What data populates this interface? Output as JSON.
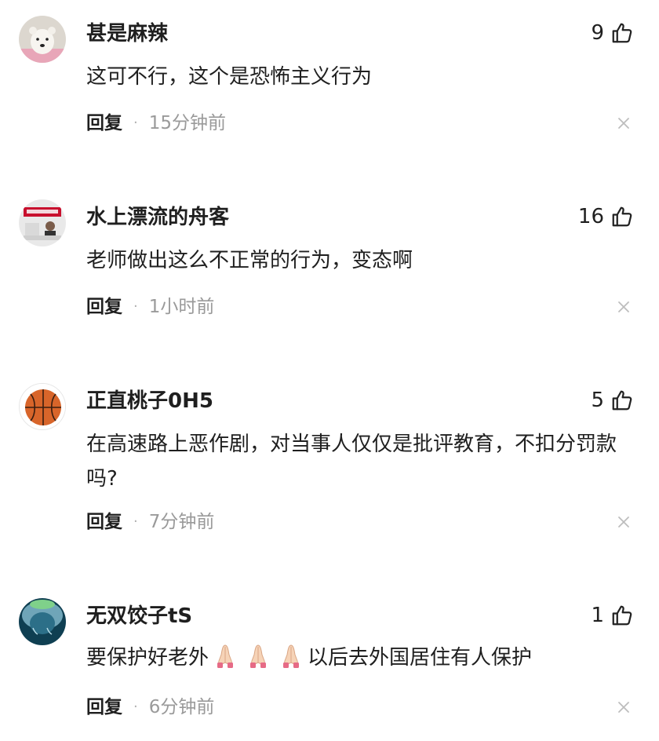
{
  "comments": [
    {
      "avatar_icon": "polar-bear-avatar",
      "name": "甚是麻辣",
      "likes": "9",
      "text": "这可不行，这个是恐怖主义行为",
      "reply_label": "回复",
      "time": "15分钟前"
    },
    {
      "avatar_icon": "office-photo-avatar",
      "name": "水上漂流的舟客",
      "likes": "16",
      "text": "老师做出这么不正常的行为，变态啊",
      "reply_label": "回复",
      "time": "1小时前"
    },
    {
      "avatar_icon": "basketball-avatar",
      "name": "正直桃子0H5",
      "likes": "5",
      "text": "在高速路上恶作剧，对当事人仅仅是批评教育，不扣分罚款吗?",
      "reply_label": "回复",
      "time": "7分钟前"
    },
    {
      "avatar_icon": "water-drop-avatar",
      "name": "无双饺子tS",
      "likes": "1",
      "text_before": "要保护好老外",
      "emoji": "folded-hands-emoji",
      "text_after": "以后去外国居住有人保护",
      "reply_label": "回复",
      "time": "6分钟前"
    }
  ],
  "colors": {
    "text": "#1f1f1f",
    "meta": "#9a9a9a",
    "icon": "#222222",
    "close": "#bdbdbd"
  }
}
